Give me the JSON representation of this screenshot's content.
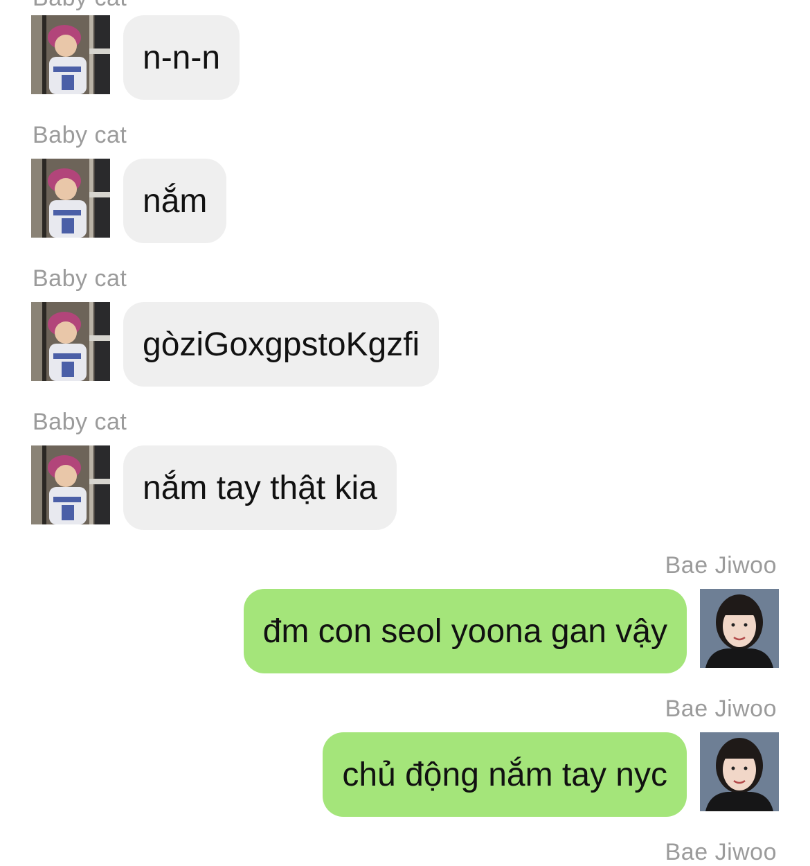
{
  "messages": [
    {
      "sender": "Baby cat",
      "text": "n-n-n",
      "side": "left"
    },
    {
      "sender": "Baby cat",
      "text": "nắm",
      "side": "left"
    },
    {
      "sender": "Baby cat",
      "text": "gòziGoxgpstoKgzfi",
      "side": "left"
    },
    {
      "sender": "Baby cat",
      "text": "nắm tay thật kia",
      "side": "left"
    },
    {
      "sender": "Bae Jiwoo",
      "text": "đm con seol yoona gan vậy",
      "side": "right"
    },
    {
      "sender": "Bae Jiwoo",
      "text": "chủ động nắm tay nyc",
      "side": "right"
    },
    {
      "sender": "Bae Jiwoo",
      "side": "right"
    }
  ],
  "colors": {
    "incoming_bubble": "#efefef",
    "outgoing_bubble": "#a4e57a",
    "sender_name": "#9b9b9b"
  },
  "icons": {
    "cat_avatar": "child-photo-avatar",
    "jiwoo_avatar": "girl-portrait-avatar"
  }
}
